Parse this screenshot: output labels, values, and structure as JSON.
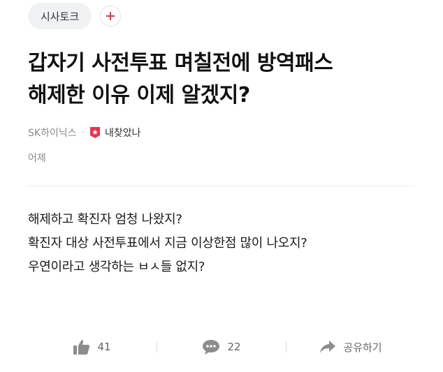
{
  "topic": {
    "label": "시사토크",
    "follow_label": "+"
  },
  "post": {
    "title_line1": "갑자기 사전투표 며칠전에 방역패스",
    "title_line2": "해제한 이유 이제 알겠지?",
    "company": "SK하이닉스",
    "separator": "·",
    "nickname": "내찾았나",
    "time": "어제",
    "body": [
      "해제하고 확진자 엄청 나왔지?",
      "확진자 대상 사전투표에서 지금 이상한점 많이 나오지?",
      "우연이라고 생각하는 ㅂㅅ들 없지?"
    ]
  },
  "actions": {
    "like_count": "41",
    "comment_count": "22",
    "share_label": "공유하기"
  },
  "colors": {
    "badge_red": "#e8344e",
    "plus_red": "#e8344e",
    "icon_gray": "#8c8c8c"
  }
}
